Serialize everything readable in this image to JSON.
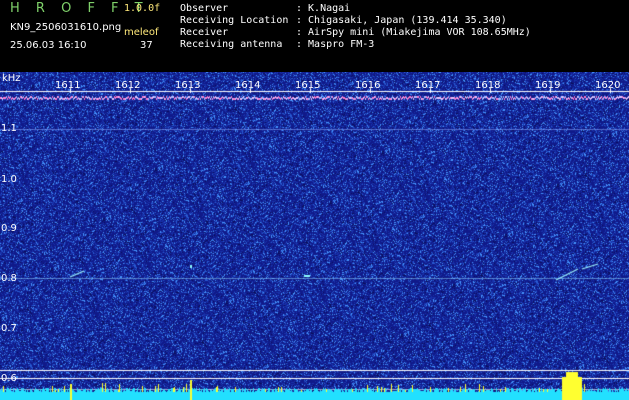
{
  "header": {
    "app_title": "H R O F F T",
    "version": "1.0.0f",
    "file_name": "KN9_2506031610.png",
    "mode": "meleof",
    "datetime": "25.06.03 16:10",
    "count": "37",
    "info": [
      {
        "key": "Observer",
        "value": ": K.Nagai"
      },
      {
        "key": "Receiving Location",
        "value": ": Chigasaki, Japan (139.414 35.340)"
      },
      {
        "key": "Receiver",
        "value": ": AirSpy mini (Miakejima VOR 108.65MHz)"
      },
      {
        "key": "Receiving antenna",
        "value": ": Maspro FM-3"
      }
    ]
  },
  "spectrogram": {
    "y_unit": "kHz",
    "y_ticks": [
      "1.1",
      "1.0",
      "0.9",
      "0.8",
      "0.7",
      "0.6"
    ],
    "x_ticks": [
      "1611",
      "1612",
      "1613",
      "1614",
      "1615",
      "1616",
      "1617",
      "1618",
      "1619",
      "1620"
    ],
    "background_color": "#101a8a",
    "noise_color": "#3a9cff",
    "baseline_color": "#22e0ff",
    "burst_color": "#ffff30"
  }
}
